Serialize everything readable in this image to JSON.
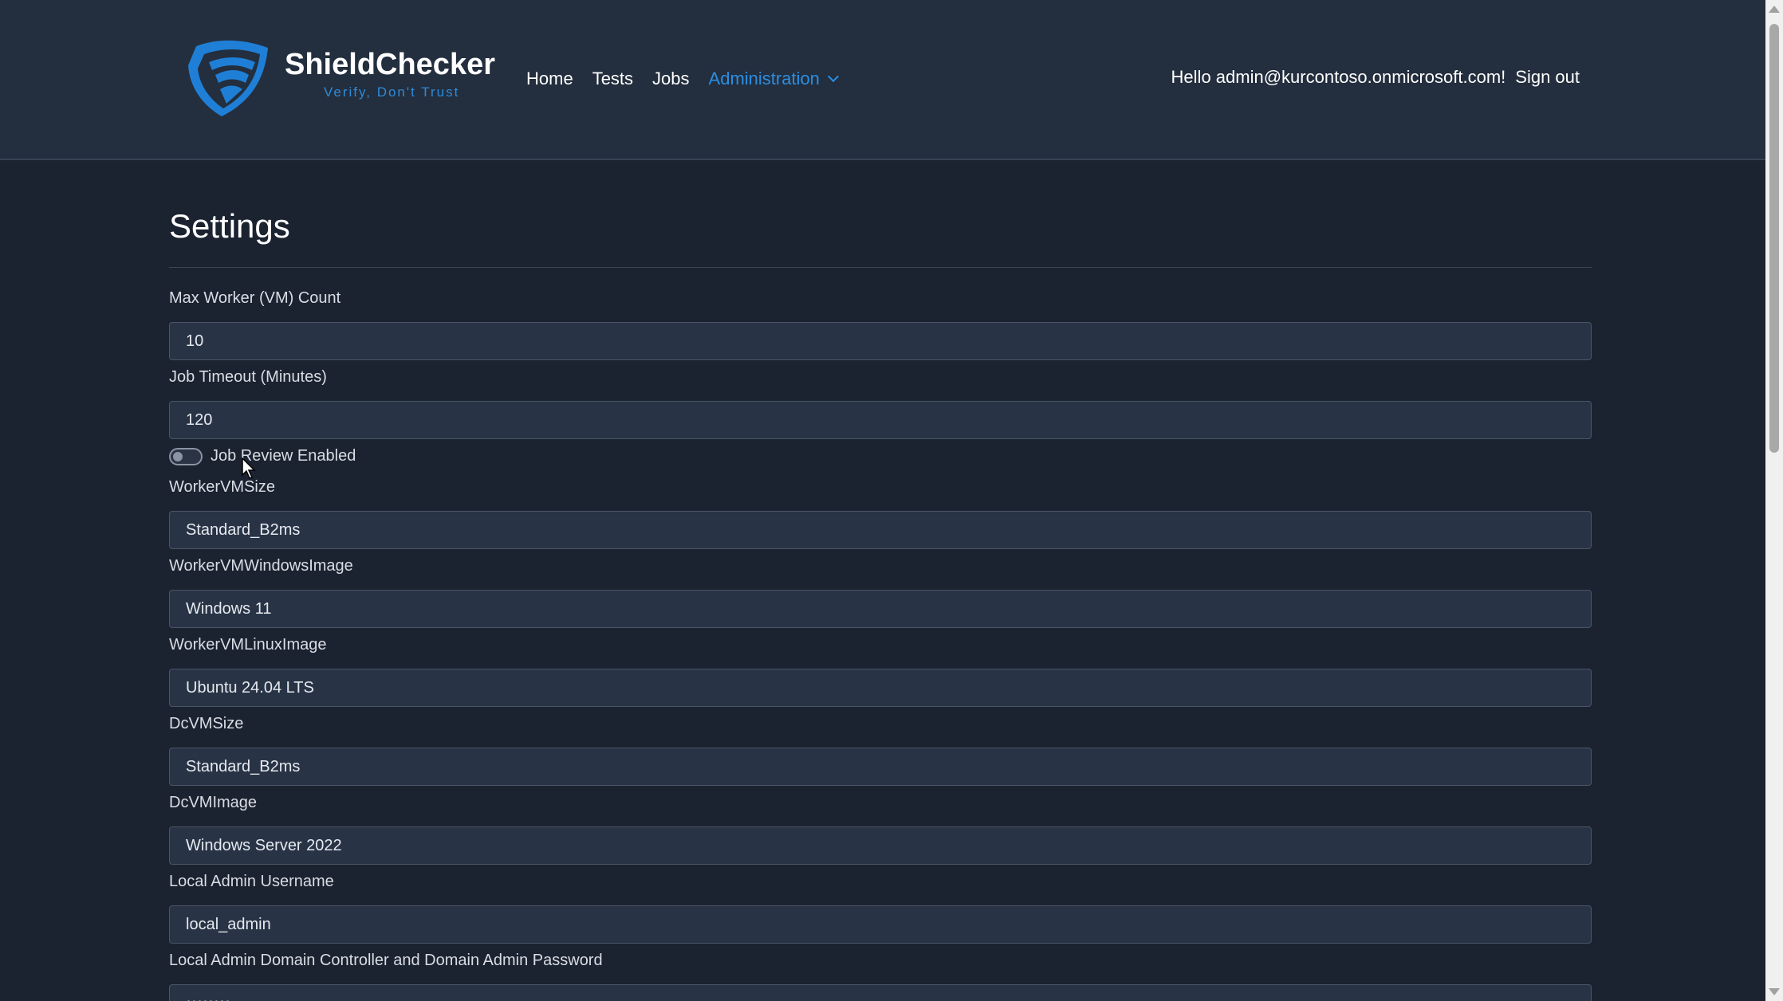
{
  "brand": {
    "name": "ShieldChecker",
    "tagline": "Verify, Don't Trust"
  },
  "nav": {
    "home": "Home",
    "tests": "Tests",
    "jobs": "Jobs",
    "administration": "Administration",
    "administration_icon": "chevron-down-icon"
  },
  "user": {
    "greeting": "Hello admin@kurcontoso.onmicrosoft.com!",
    "signout": "Sign out"
  },
  "page": {
    "title": "Settings"
  },
  "settings": {
    "max_worker_label": "Max Worker (VM) Count",
    "max_worker_value": "10",
    "job_timeout_label": "Job Timeout (Minutes)",
    "job_timeout_value": "120",
    "job_review_label": "Job Review Enabled",
    "job_review_enabled": false,
    "worker_vm_size_label": "WorkerVMSize",
    "worker_vm_size_value": "Standard_B2ms",
    "worker_vm_windows_image_label": "WorkerVMWindowsImage",
    "worker_vm_windows_image_value": "Windows 11",
    "worker_vm_linux_image_label": "WorkerVMLinuxImage",
    "worker_vm_linux_image_value": "Ubuntu 24.04 LTS",
    "dc_vm_size_label": "DcVMSize",
    "dc_vm_size_value": "Standard_B2ms",
    "dc_vm_image_label": "DcVMImage",
    "dc_vm_image_value": "Windows Server 2022",
    "local_admin_username_label": "Local Admin Username",
    "local_admin_username_value": "local_admin",
    "local_admin_password_label": "Local Admin Domain Controller and Domain Admin Password",
    "local_admin_password_value": "••••••••"
  },
  "colors": {
    "accent": "#2b8fe3",
    "navbar_bg": "#232e3e",
    "page_bg": "#1b2230",
    "input_bg": "#283446"
  }
}
